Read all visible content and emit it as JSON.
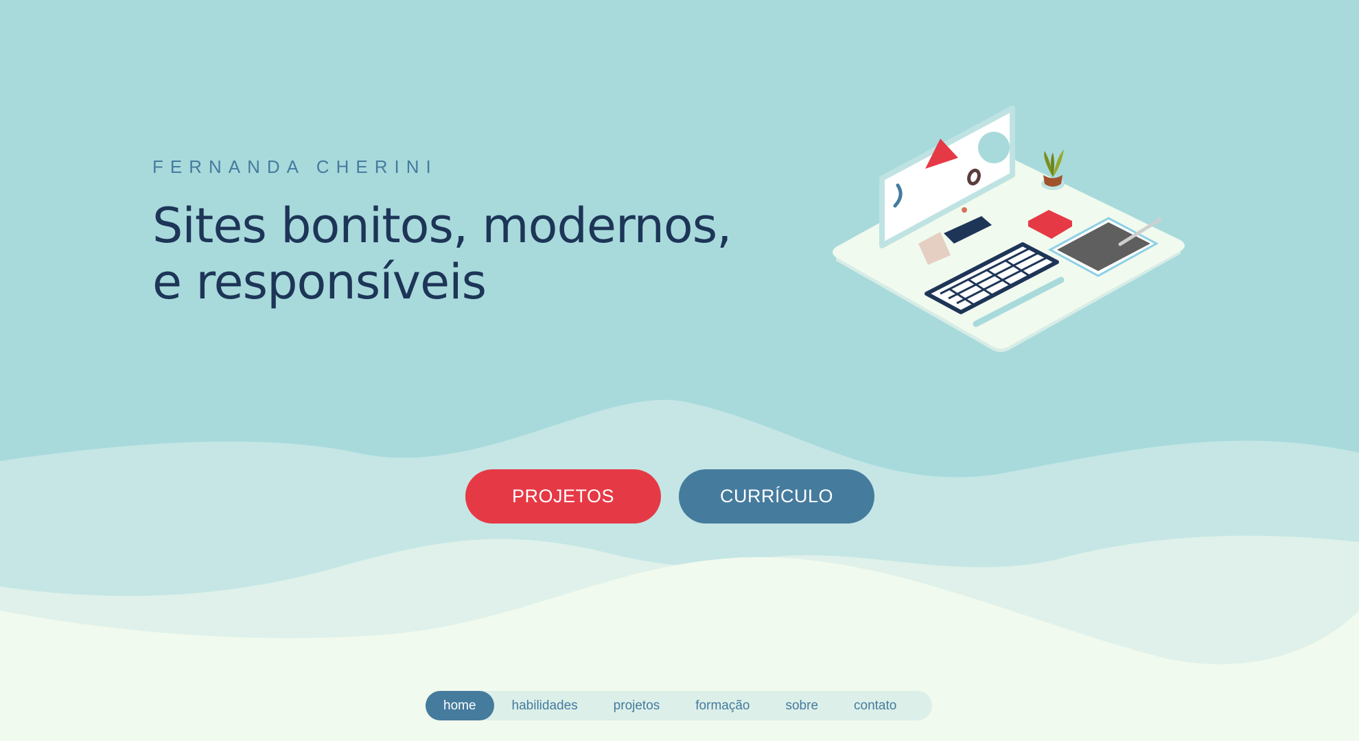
{
  "hero": {
    "eyebrow": "FERNANDA CHERINI",
    "headline_line1": "Sites bonitos, modernos,",
    "headline_line2": "e responsíveis"
  },
  "buttons": {
    "projects_label": "PROJETOS",
    "resume_label": "CURRÍCULO"
  },
  "nav": {
    "items": [
      {
        "label": "home",
        "active": true
      },
      {
        "label": "habilidades",
        "active": false
      },
      {
        "label": "projetos",
        "active": false
      },
      {
        "label": "formação",
        "active": false
      },
      {
        "label": "sobre",
        "active": false
      },
      {
        "label": "contato",
        "active": false
      }
    ]
  },
  "colors": {
    "background": "#a8dadc",
    "wave_light": "#c5e6e5",
    "wave_lighter": "#dff1ea",
    "wave_lightest": "#f1faee",
    "primary_red": "#e63946",
    "primary_blue": "#457b9d",
    "navy": "#1d3557"
  },
  "illustration": {
    "icons": [
      "computer-monitor-icon",
      "keyboard-icon",
      "tablet-icon",
      "stylus-icon",
      "plant-icon",
      "sticky-note-icon"
    ]
  }
}
